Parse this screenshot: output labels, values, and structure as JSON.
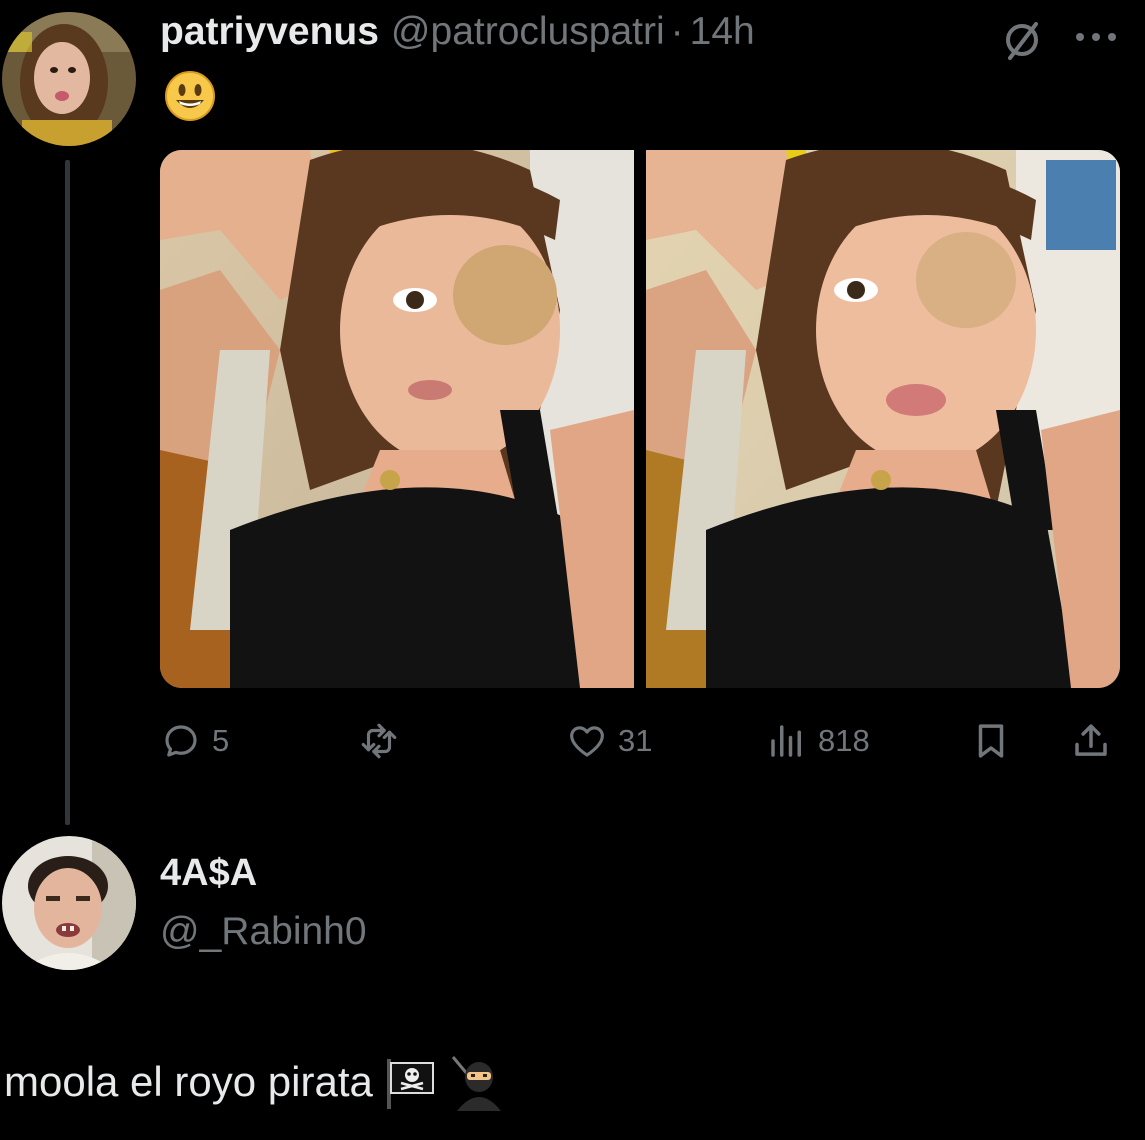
{
  "tweet": {
    "display_name": "patriyvenus",
    "handle": "@patrocluspatri",
    "separator": "·",
    "time": "14h",
    "text_emoji": "smiling-face-emoji",
    "media": [
      {
        "description_icon": "selfie-photo-1"
      },
      {
        "description_icon": "selfie-photo-2"
      }
    ],
    "actions": {
      "replies": "5",
      "retweets": "",
      "likes": "31",
      "views": "818"
    }
  },
  "reply": {
    "display_name": "4A$A",
    "handle": "@_Rabinh0",
    "text": "moola el royo pirata",
    "emojis": [
      "pirate-flag-emoji",
      "ninja-emoji"
    ]
  },
  "colors": {
    "background": "#000000",
    "text_primary": "#e7e9ea",
    "text_secondary": "#71767b",
    "thread_line": "#333639"
  }
}
